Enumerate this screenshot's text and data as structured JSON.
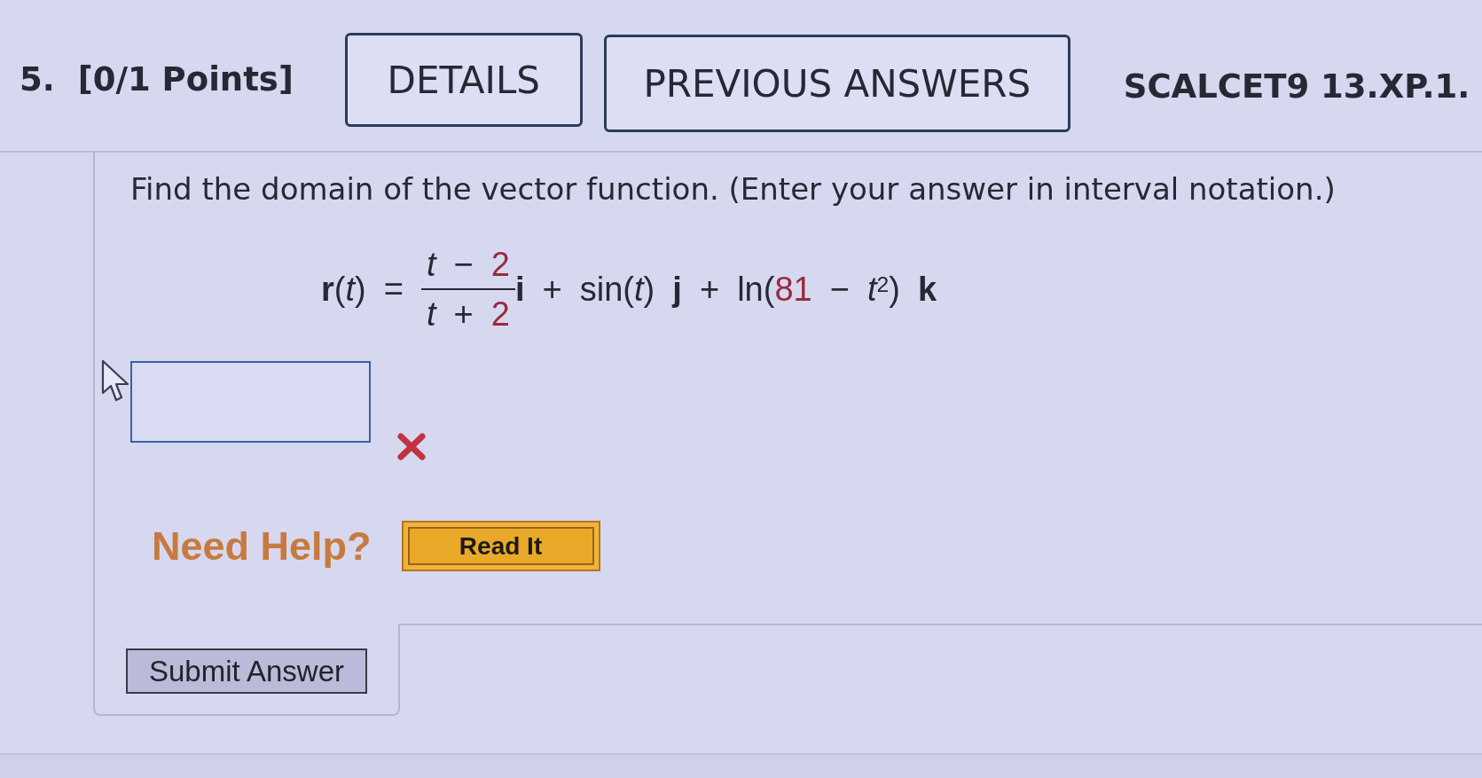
{
  "header": {
    "number": "5.",
    "points": "[0/1 Points]",
    "buttons": [
      {
        "label": "DETAILS"
      },
      {
        "label": "PREVIOUS ANSWERS"
      }
    ],
    "code": "SCALCET9 13.XP.1."
  },
  "prompt": "Find the domain of the vector function. (Enter your answer in interval notation.)",
  "formula": {
    "lhs": [
      {
        "kind": "vec",
        "text": "r"
      },
      {
        "kind": "op",
        "text": "("
      },
      {
        "kind": "var",
        "text": "t"
      },
      {
        "kind": "op",
        "text": ")"
      }
    ],
    "relation": "=",
    "numerator": [
      {
        "kind": "var",
        "text": "t"
      },
      {
        "kind": "op",
        "text": " − "
      },
      {
        "kind": "param",
        "text": "2"
      }
    ],
    "denominator": [
      {
        "kind": "var",
        "text": "t"
      },
      {
        "kind": "op",
        "text": " + "
      },
      {
        "kind": "param",
        "text": "2"
      }
    ],
    "rhs": [
      {
        "kind": "vec",
        "text": "i"
      },
      {
        "kind": "op",
        "text": " + sin("
      },
      {
        "kind": "var",
        "text": "t"
      },
      {
        "kind": "op",
        "text": ") "
      },
      {
        "kind": "vec",
        "text": "j"
      },
      {
        "kind": "op",
        "text": " + ln("
      },
      {
        "kind": "param",
        "text": "81"
      },
      {
        "kind": "op",
        "text": " − "
      },
      {
        "kind": "var",
        "text": "t"
      },
      {
        "kind": "sup",
        "text": "2"
      },
      {
        "kind": "op",
        "text": ") "
      },
      {
        "kind": "vec",
        "text": "k"
      }
    ]
  },
  "answer": {
    "correct": false
  },
  "help": {
    "label": "Need Help?",
    "buttons": [
      {
        "label": "Read It"
      }
    ]
  },
  "submit": {
    "label": "Submit Answer"
  }
}
